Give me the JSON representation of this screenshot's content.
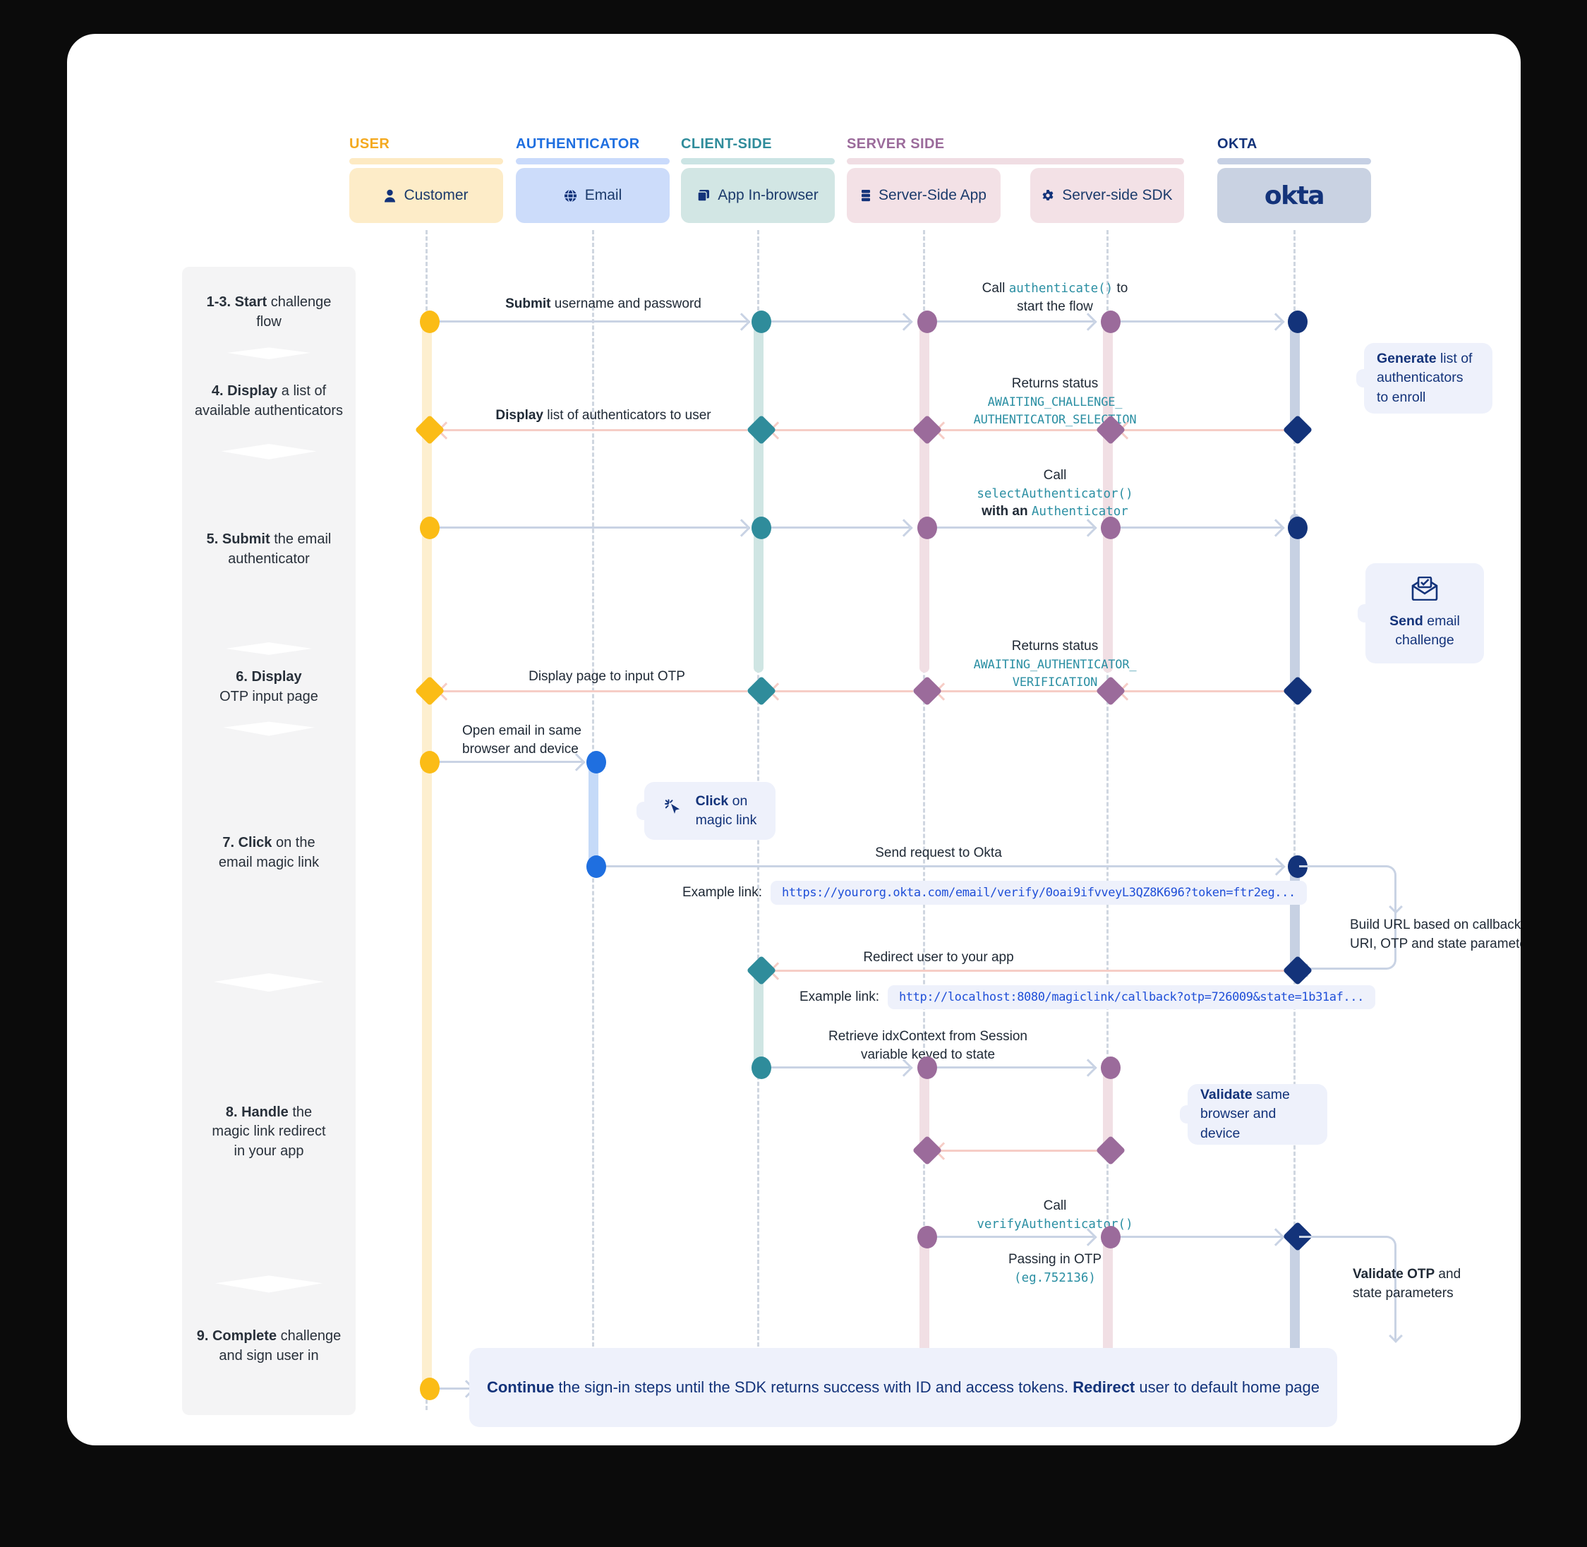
{
  "columns": [
    {
      "title": "USER",
      "accent": "#f4a91f",
      "rule": "#fdeac3",
      "box_bg": "#fdecc8",
      "actor": "Customer",
      "icon": "person-icon"
    },
    {
      "title": "AUTHENTICATOR",
      "accent": "#1f6fe0",
      "rule": "#c9dafb",
      "box_bg": "#ccdcfa",
      "actor": "Email",
      "icon": "globe-icon"
    },
    {
      "title": "CLIENT-SIDE",
      "accent": "#2f8c9b",
      "rule": "#cbe4e4",
      "box_bg": "#d2e6e4",
      "actor": "App In-browser",
      "icon": "browser-icon"
    },
    {
      "title": "SERVER SIDE",
      "accent": "#9b6b9b",
      "rule": "#f0dde3",
      "box_bg": "#f3e1e6",
      "actor": "Server-Side App",
      "icon": "server-icon"
    },
    {
      "title": "",
      "accent": "#9b6b9b",
      "rule": "#f0dde3",
      "box_bg": "#f3e1e6",
      "actor": "Server-side SDK",
      "icon": "gear-icon"
    },
    {
      "title": "OKTA",
      "accent": "#13337a",
      "rule": "#c6d0e4",
      "box_bg": "#c9d2e2",
      "actor": "okta",
      "icon": "okta-logo"
    }
  ],
  "steps": [
    {
      "bold": "1-3. Start",
      "rest": " challenge",
      "line2": "flow"
    },
    {
      "bold": "4. Display",
      "rest": " a list of",
      "line2": "available authenticators"
    },
    {
      "bold": "5. Submit",
      "rest": " the email",
      "line2": "authenticator"
    },
    {
      "bold": "6. Display",
      "rest": "",
      "line2": "OTP input page"
    },
    {
      "bold": "7. Click",
      "rest": " on the",
      "line2": "email magic link"
    },
    {
      "bold": "8. Handle",
      "rest": " the",
      "line2": "magic link redirect",
      "line3": "in your app"
    },
    {
      "bold": "9. Complete",
      "rest": " challenge",
      "line2": "and sign user in"
    }
  ],
  "messages": {
    "submit_credentials": {
      "bold": "Submit",
      "rest": " username and password"
    },
    "call_authenticate_1": "Call",
    "call_authenticate_code": "authenticate()",
    "call_authenticate_2": " to",
    "call_authenticate_3": "start the flow",
    "returns_status_1": "Returns status",
    "status_awaiting_challenge_l1": "AWAITING_CHALLENGE_",
    "status_awaiting_challenge_l2": "AUTHENTICATOR_SELECTION",
    "display_list": {
      "bold": "Display",
      "rest": " list of authenticators to user"
    },
    "call_select_l1": "Call",
    "call_select_code": "selectAuthenticator()",
    "call_select_l3_bold": "with an ",
    "call_select_l3_code": "Authenticator",
    "returns_status_2": "Returns status",
    "status_awaiting_verification_l1": "AWAITING_AUTHENTICATOR_",
    "status_awaiting_verification_l2": "VERIFICATION",
    "display_otp_page": "Display page to input OTP",
    "open_email_l1": "Open email in same",
    "open_email_l2": "browser and device",
    "send_request": "Send request to Okta",
    "example_link_caption": "Example link:",
    "example_link_okta": "https://yourorg.okta.com/email/verify/0oai9ifvveyL3QZ8K696?token=ftr2eg...",
    "redirect_user": "Redirect user to your app",
    "example_link_caption_2": "Example link:",
    "example_link_callback": "http://localhost:8080/magiclink/callback?otp=726009&state=1b31af...",
    "retrieve_idx_l1": "Retrieve idxContext from Session",
    "retrieve_idx_l2": "variable keyed to state",
    "call_verify_l1": "Call",
    "call_verify_code": "verifyAuthenticator()",
    "passing_otp": "Passing in OTP",
    "passing_otp_code": "(eg.752136)"
  },
  "bubbles": {
    "generate": {
      "bold": "Generate",
      "rest": " list of",
      "line2": "authenticators",
      "line3": "to enroll"
    },
    "send_email": {
      "icon": "email-check-icon",
      "bold": "Send",
      "rest": " email",
      "line2": "challenge"
    },
    "click_link": {
      "icon": "cursor-click-icon",
      "bold": "Click",
      "rest": " on",
      "line2": "magic link"
    },
    "validate_browser": {
      "bold": "Validate",
      "rest": " same",
      "line2": "browser and device"
    }
  },
  "annotations": {
    "build_url_l1": "Build URL  based on callback",
    "build_url_l2": "URI, OTP and state parameters",
    "validate_otp_bold": "Validate OTP",
    "validate_otp_rest": " and",
    "validate_otp_l2": "state parameters"
  },
  "banner": {
    "b1": "Continue",
    "t1": " the sign-in steps until the SDK returns success with ID and access tokens. ",
    "b2": "Redirect",
    "t2": " user to default home page"
  }
}
